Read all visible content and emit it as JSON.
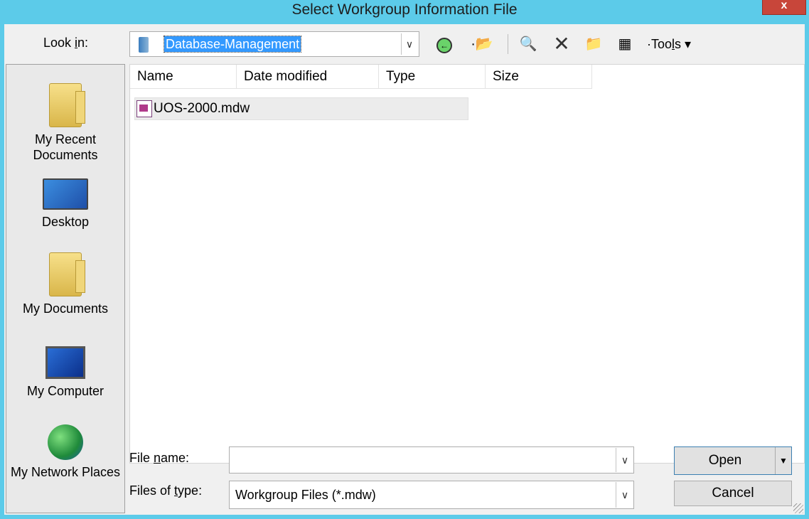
{
  "window": {
    "title": "Select Workgroup Information File",
    "close_glyph": "x"
  },
  "toolbar": {
    "look_in_label_pre": "Look ",
    "look_in_label_u": "i",
    "look_in_label_post": "n:",
    "look_in_value": "Database-Management",
    "tools_label_pre": "Too",
    "tools_label_u": "l",
    "tools_label_post": "s",
    "icons": [
      "back-icon",
      "up-folder-icon",
      "search-web-icon",
      "delete-icon",
      "new-folder-icon",
      "views-icon"
    ]
  },
  "places": [
    {
      "label": "My Recent Documents",
      "icon": "recent-documents-icon"
    },
    {
      "label": "Desktop",
      "icon": "desktop-icon"
    },
    {
      "label": "My Documents",
      "icon": "my-documents-icon"
    },
    {
      "label": "My Computer",
      "icon": "my-computer-icon"
    },
    {
      "label": "My Network Places",
      "icon": "network-places-icon"
    }
  ],
  "file_list": {
    "columns": [
      "Name",
      "Date modified",
      "Type",
      "Size"
    ],
    "files": [
      {
        "name": "UOS-2000.mdw"
      }
    ]
  },
  "footer": {
    "file_name_label_pre": "File ",
    "file_name_label_u": "n",
    "file_name_label_post": "ame:",
    "file_name_value": "",
    "files_of_type_label_pre": "Files of ",
    "files_of_type_label_u": "t",
    "files_of_type_label_post": "ype:",
    "files_of_type_value": "Workgroup Files (*.mdw)",
    "open_label": "Open",
    "cancel_label": "Cancel"
  },
  "colors": {
    "title_bar": "#5ccbe9",
    "close_button": "#c8463a",
    "selection": "#3399ff"
  }
}
